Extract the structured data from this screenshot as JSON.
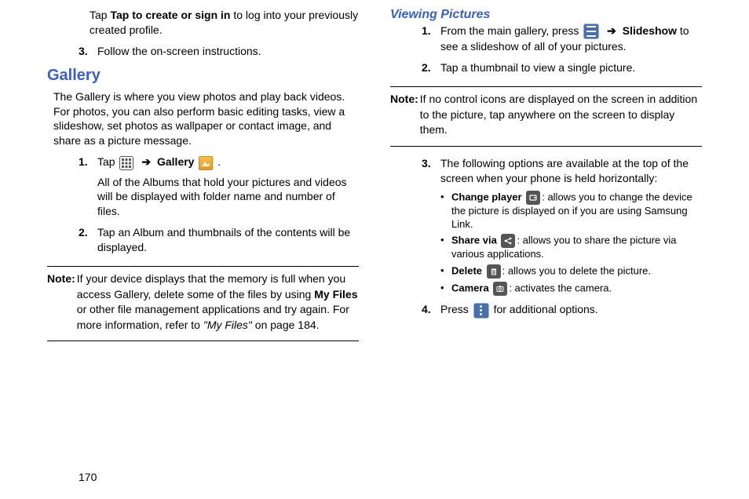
{
  "pageNumber": "170",
  "leftCol": {
    "introStepTail": {
      "pre": "Tap ",
      "bold": "Tap to create or sign in",
      "post": " to log into your previously created profile."
    },
    "step3": "Follow the on-screen instructions.",
    "sectionTitle": "Gallery",
    "galleryIntro": "The Gallery is where you view photos and play back videos. For photos, you can also perform basic editing tasks, view a slideshow, set photos as wallpaper or contact image, and share as a picture message.",
    "g_step1": {
      "tap": "Tap ",
      "arrow": "➔",
      "galleryLabel": "Gallery",
      "period": ".",
      "cont": "All of the Albums that hold your pictures and videos will be displayed with folder name and number of files."
    },
    "g_step2": "Tap an Album and thumbnails of the contents will be displayed.",
    "note1": {
      "label": "Note:",
      "body_pre": "If your device displays that the memory is full when you access Gallery, delete some of the files by using ",
      "myfiles": "My Files",
      "body_mid": " or other file management applications and try again. For more information, refer to ",
      "ref": "\"My Files\"",
      "body_post": "  on page 184."
    }
  },
  "rightCol": {
    "subTitle": "Viewing Pictures",
    "v_step1": {
      "pre": "From the main gallery, press ",
      "arrow": "➔",
      "slideshow": "Slideshow",
      "post": " to see a slideshow of all of your pictures."
    },
    "v_step2": "Tap a thumbnail to view a single picture.",
    "note2": {
      "label": "Note:",
      "body": "If no control icons are displayed on the screen in addition to the picture, tap anywhere on the screen to display them."
    },
    "v_step3": "The following options are available at the top of the screen when your phone is held horizontally:",
    "bullets": {
      "changePlayer": {
        "label": "Change player",
        "desc": ": allows you to change the device the picture is displayed on if you are using Samsung Link."
      },
      "shareVia": {
        "label": "Share via",
        "desc": ": allows you to share the picture via various applications."
      },
      "delete": {
        "label": "Delete",
        "desc": ": allows you to delete the picture."
      },
      "camera": {
        "label": "Camera",
        "desc": ": activates the camera."
      }
    },
    "v_step4": {
      "pre": "Press ",
      "post": " for additional options."
    }
  }
}
